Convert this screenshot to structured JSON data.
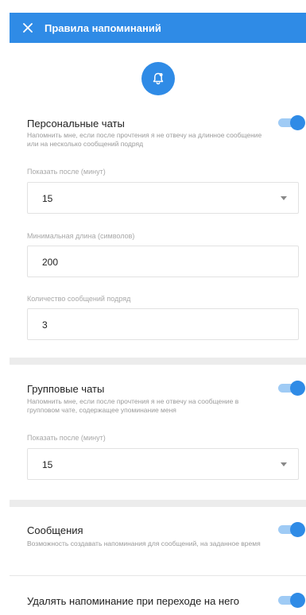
{
  "header": {
    "title": "Правила напоминаний"
  },
  "personal": {
    "title": "Персональные чаты",
    "desc": "Напомнить мне, если после прочтения я не отвечу на длинное сообщение или на несколько сообщений подряд",
    "show_after_label": "Показать после (минут)",
    "show_after_value": "15",
    "min_length_label": "Минимальная длина (символов)",
    "min_length_value": "200",
    "count_label": "Количество сообщений подряд",
    "count_value": "3",
    "enabled": true
  },
  "group": {
    "title": "Групповые чаты",
    "desc": "Напомнить мне, если после прочтения я не отвечу на сообщение в групповом чате, содержащее упоминание меня",
    "show_after_label": "Показать после (минут)",
    "show_after_value": "15",
    "enabled": true
  },
  "messages": {
    "title": "Сообщения",
    "desc": "Возможность создавать напоминания для сообщений, на заданное время",
    "enabled": true
  },
  "delete_on_open": {
    "title": "Удалять напоминание при переходе на него",
    "enabled": true
  },
  "colors": {
    "accent": "#2f8be6",
    "track": "#9fcbf5"
  },
  "icons": {
    "close": "close-icon",
    "bell": "bell-icon",
    "dropdown": "chevron-down-icon"
  }
}
